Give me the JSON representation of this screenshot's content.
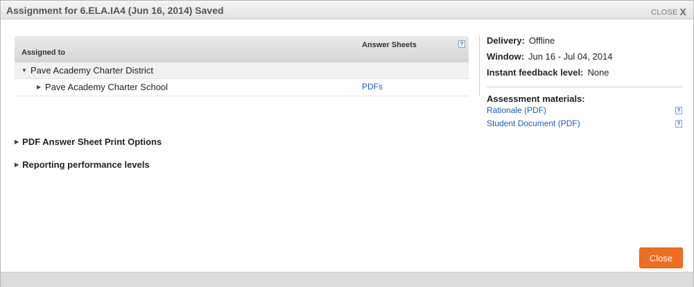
{
  "dialog": {
    "title": "Assignment for 6.ELA.IA4 (Jun 16, 2014) Saved",
    "close_label": "CLOSE",
    "close_x": "X"
  },
  "table": {
    "col_assigned": "Assigned to",
    "col_answer_sheets": "Answer Sheets",
    "help": "?",
    "district": "Pave Academy Charter District",
    "school": "Pave Academy Charter School",
    "school_link": "PDFs"
  },
  "sections": {
    "print_options": "PDF Answer Sheet Print Options",
    "performance_levels": "Reporting performance levels"
  },
  "details": {
    "delivery_label": "Delivery:",
    "delivery_value": "Offline",
    "window_label": "Window:",
    "window_value": "Jun 16 - Jul 04, 2014",
    "feedback_label": "Instant feedback level:",
    "feedback_value": "None"
  },
  "materials": {
    "heading": "Assessment materials:",
    "items": [
      {
        "label": "Rationale (PDF)",
        "help": "?"
      },
      {
        "label": "Student Document (PDF)",
        "help": "?"
      }
    ]
  },
  "footer": {
    "close_button": "Close"
  },
  "colors": {
    "accent": "#f06d1f",
    "link": "#1a5bb8"
  }
}
